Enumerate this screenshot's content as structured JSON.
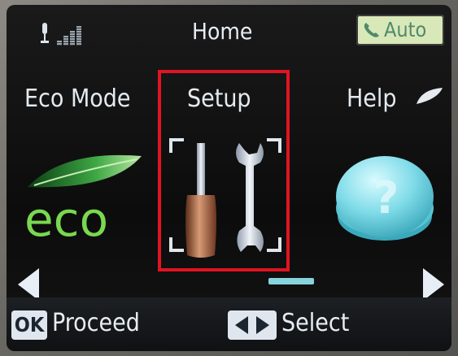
{
  "header": {
    "title": "Home",
    "mic_icon": "microphone-icon",
    "signal_icon": "signal-strength-icon",
    "auto_badge": {
      "icon": "phone-icon",
      "label": "Auto"
    }
  },
  "menu": {
    "items": [
      {
        "label": "Eco Mode",
        "icon": "eco-leaf-icon",
        "icon_text": "eco"
      },
      {
        "label": "Setup",
        "icon": "screwdriver-wrench-icon",
        "selected": true
      },
      {
        "label": "Help",
        "icon": "question-disc-icon"
      }
    ],
    "selection_color": "#e01422"
  },
  "nav": {
    "left_icon": "arrow-left-icon",
    "right_icon": "arrow-right-icon",
    "page_indicator_color": "#86d3dc"
  },
  "footer": {
    "ok_key": "OK",
    "ok_action": "Proceed",
    "select_key_icon": "left-right-arrows-icon",
    "select_action": "Select"
  }
}
